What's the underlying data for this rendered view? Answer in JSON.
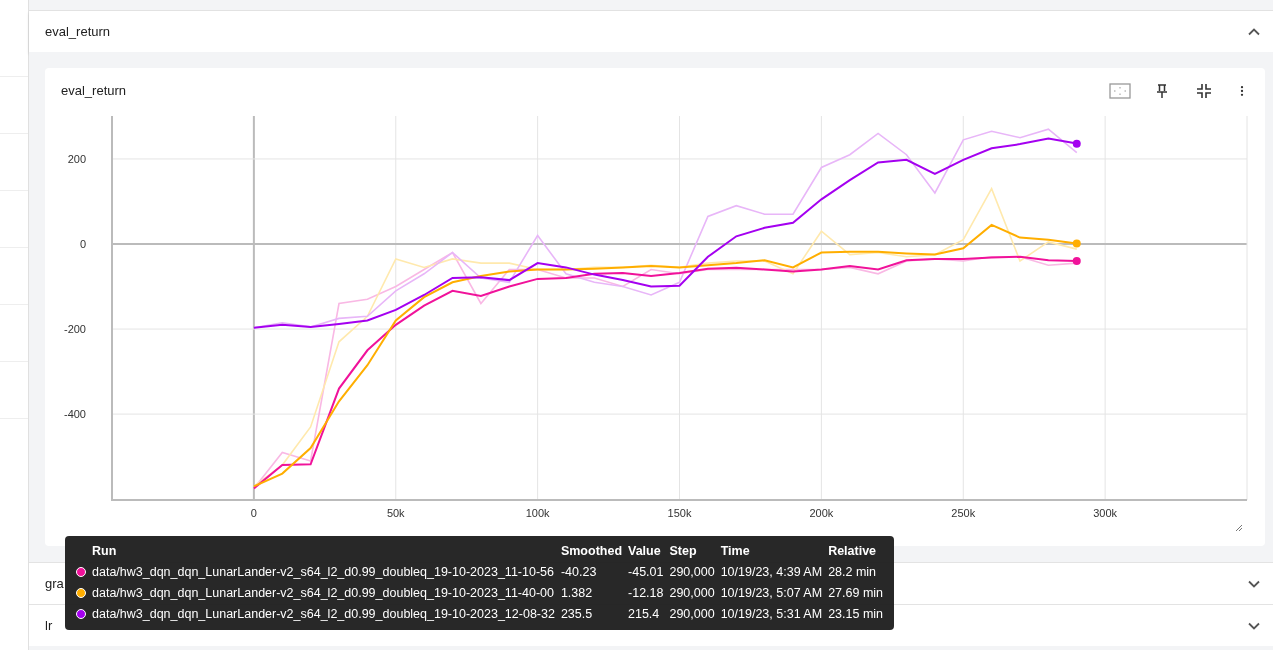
{
  "sections": [
    {
      "title": "eval_return",
      "expanded": true,
      "card": {
        "title": "eval_return",
        "chart_data": {
          "type": "line",
          "grid": true,
          "xlim": [
            -50000,
            350000
          ],
          "ylim": [
            -602,
            301
          ],
          "xticks": [
            {
              "value": 0,
              "label": "0"
            },
            {
              "value": 50000,
              "label": "50k"
            },
            {
              "value": 100000,
              "label": "100k"
            },
            {
              "value": 150000,
              "label": "150k"
            },
            {
              "value": 200000,
              "label": "200k"
            },
            {
              "value": 250000,
              "label": "250k"
            },
            {
              "value": 300000,
              "label": "300k"
            }
          ],
          "yticks": [
            -400,
            -200,
            0,
            200
          ],
          "x": [
            0,
            10000,
            20000,
            30000,
            40000,
            50000,
            60000,
            70000,
            80000,
            90000,
            100000,
            110000,
            120000,
            130000,
            140000,
            150000,
            160000,
            170000,
            180000,
            190000,
            200000,
            210000,
            220000,
            230000,
            240000,
            250000,
            260000,
            270000,
            280000,
            290000
          ],
          "series": [
            {
              "color": "#f9b8e4",
              "values": [
                -575,
                -490,
                -510,
                -140,
                -130,
                -100,
                -60,
                -20,
                -140,
                -60,
                -60,
                -80,
                -80,
                -100,
                -60,
                -70,
                -60,
                -60,
                -60,
                -60,
                -60,
                -55,
                -70,
                -40,
                -35,
                -40,
                -30,
                -30,
                -50,
                -45
              ]
            },
            {
              "color": "#ffe9ad",
              "values": [
                -570,
                -520,
                -430,
                -230,
                -170,
                -35,
                -55,
                -35,
                -45,
                -45,
                -60,
                -60,
                -55,
                -55,
                -50,
                -55,
                -45,
                -40,
                -40,
                -70,
                30,
                -25,
                -20,
                -30,
                -25,
                10,
                130,
                -40,
                5,
                -12
              ]
            },
            {
              "color": "#e8b6f8",
              "values": [
                -197,
                -185,
                -195,
                -175,
                -170,
                -110,
                -70,
                -20,
                -80,
                -90,
                20,
                -70,
                -90,
                -100,
                -120,
                -90,
                65,
                90,
                70,
                70,
                180,
                210,
                260,
                210,
                120,
                245,
                265,
                250,
                270,
                215
              ]
            },
            {
              "color": "#f0129a",
              "values": [
                -575,
                -520,
                -518,
                -340,
                -250,
                -190,
                -145,
                -110,
                -122,
                -100,
                -82,
                -80,
                -70,
                -68,
                -75,
                -68,
                -58,
                -56,
                -60,
                -65,
                -60,
                -52,
                -60,
                -38,
                -35,
                -35,
                -32,
                -30,
                -38,
                -40
              ]
            },
            {
              "color": "#ffae00",
              "values": [
                -570,
                -540,
                -480,
                -370,
                -285,
                -180,
                -125,
                -90,
                -75,
                -65,
                -60,
                -60,
                -58,
                -55,
                -52,
                -55,
                -50,
                -45,
                -38,
                -55,
                -20,
                -18,
                -18,
                -22,
                -25,
                -10,
                45,
                15,
                10,
                1
              ]
            },
            {
              "color": "#a400f0",
              "values": [
                -197,
                -190,
                -195,
                -188,
                -180,
                -155,
                -120,
                -80,
                -78,
                -85,
                -45,
                -55,
                -72,
                -85,
                -100,
                -98,
                -30,
                18,
                38,
                50,
                105,
                150,
                192,
                198,
                165,
                198,
                225,
                235,
                248,
                236
              ]
            }
          ]
        }
      }
    },
    {
      "title": "gra",
      "expanded": false
    },
    {
      "title": "lr",
      "expanded": false
    }
  ],
  "tooltip": {
    "columns": [
      "Run",
      "Smoothed",
      "Value",
      "Step",
      "Time",
      "Relative"
    ],
    "rows": [
      {
        "color": "#f0129a",
        "cells": [
          "data/hw3_dqn_dqn_LunarLander-v2_s64_l2_d0.99_doubleq_19-10-2023_11-10-56",
          "-40.23",
          "-45.01",
          "290,000",
          "10/19/23, 4:39 AM",
          "28.2 min"
        ]
      },
      {
        "color": "#ffae00",
        "cells": [
          "data/hw3_dqn_dqn_LunarLander-v2_s64_l2_d0.99_doubleq_19-10-2023_11-40-00",
          "1.382",
          "-12.18",
          "290,000",
          "10/19/23, 5:07 AM",
          "27.69 min"
        ]
      },
      {
        "color": "#a400f0",
        "cells": [
          "data/hw3_dqn_dqn_LunarLander-v2_s64_l2_d0.99_doubleq_19-10-2023_12-08-32",
          "235.5",
          "215.4",
          "290,000",
          "10/19/23, 5:31 AM",
          "23.15 min"
        ]
      }
    ]
  }
}
